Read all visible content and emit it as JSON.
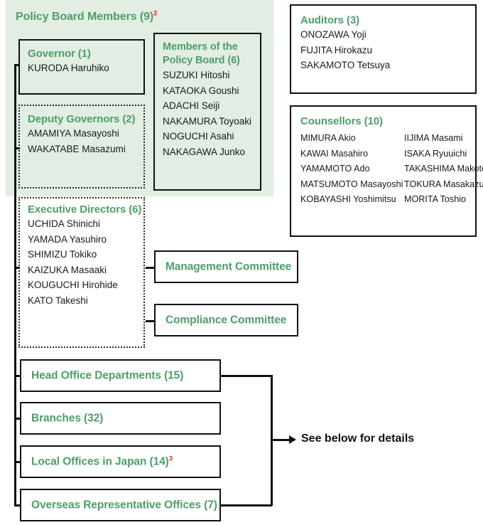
{
  "policy_board_panel": {
    "title": "Policy Board Members (9)",
    "title_superscript": "2",
    "governor": {
      "heading": "Governor (1)",
      "members": [
        "KURODA Haruhiko"
      ]
    },
    "deputy_governors": {
      "heading": "Deputy Governors (2)",
      "members": [
        "AMAMIYA Masayoshi",
        "WAKATABE Masazumi"
      ]
    },
    "members_of_policy_board": {
      "heading_line1": "Members of the",
      "heading_line2": "Policy Board (6)",
      "members": [
        "SUZUKI Hitoshi",
        "KATAOKA Goushi",
        "ADACHI Seiji",
        "NAKAMURA Toyoaki",
        "NOGUCHI Asahi",
        "NAKAGAWA Junko"
      ]
    }
  },
  "executive_directors": {
    "heading": "Executive Directors (6)",
    "members": [
      "UCHIDA Shinichi",
      "YAMADA Yasuhiro",
      "SHIMIZU Tokiko",
      "KAIZUKA Masaaki",
      "KOUGUCHI Hirohide",
      "KATO Takeshi"
    ]
  },
  "auditors": {
    "heading": "Auditors (3)",
    "members": [
      "ONOZAWA Yoji",
      "FUJITA Hirokazu",
      "SAKAMOTO Tetsuya"
    ]
  },
  "counsellors": {
    "heading": "Counsellors (10)",
    "column1": [
      "MIMURA Akio",
      "KAWAI Masahiro",
      "YAMAMOTO Ado",
      "MATSUMOTO Masayoshi",
      "KOBAYASHI Yoshimitsu"
    ],
    "column2": [
      "IIJIMA Masami",
      "ISAKA Ryuuichi",
      "TAKASHIMA Makoto",
      "TOKURA Masakazu",
      "MORITA Toshio"
    ]
  },
  "committees": [
    {
      "label": "Management Committee"
    },
    {
      "label": "Compliance Committee"
    }
  ],
  "org_units": [
    {
      "label": "Head Office Departments (15)",
      "superscript": ""
    },
    {
      "label": "Branches (32)",
      "superscript": ""
    },
    {
      "label": "Local Offices in Japan (14)",
      "superscript": "3"
    },
    {
      "label": "Overseas Representative Offices (7)",
      "superscript": ""
    }
  ],
  "footnote_pointer": {
    "label": "See below for details"
  },
  "colors": {
    "heading_green": "#4e9e6a",
    "panel_green": "#e2ede3",
    "superscript_red": "#e02020",
    "border_black": "#111111",
    "body_text": "#1a1a1a"
  }
}
